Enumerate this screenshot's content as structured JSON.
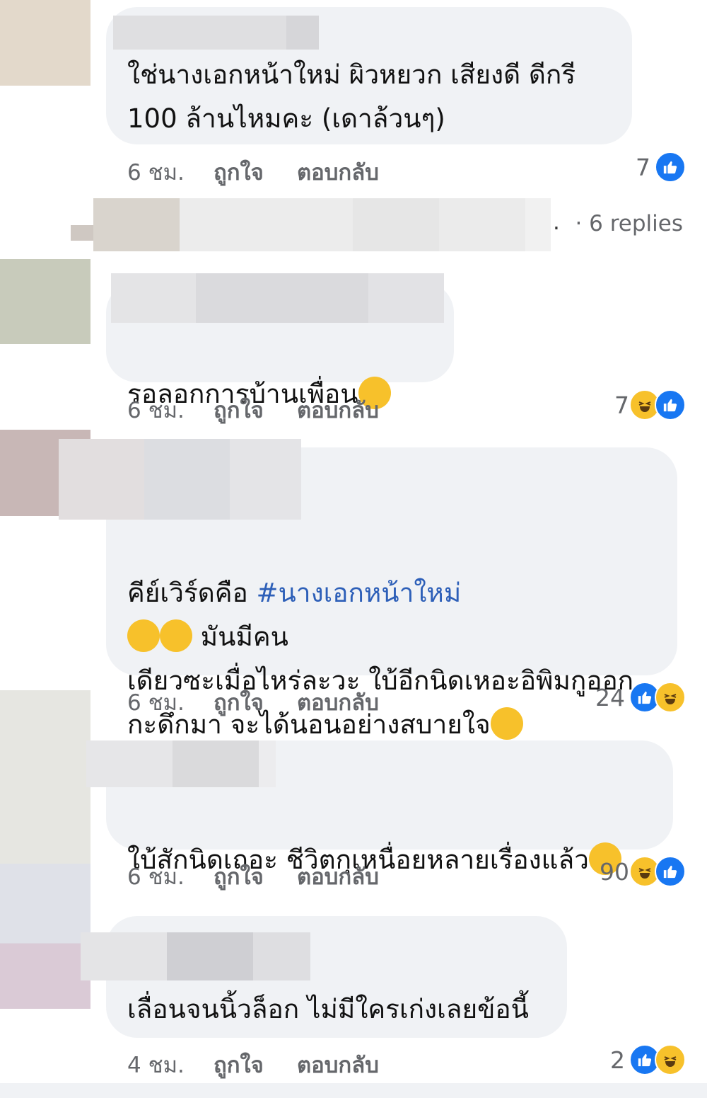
{
  "colors": {
    "bubble": "#f0f2f5",
    "meta": "#65676b",
    "like_blue": "#1877f2",
    "haha_yellow": "#f7c12b",
    "hashtag": "#2d5fb8"
  },
  "comments": [
    {
      "text": "ใช่นางเอกหน้าใหม่ ผิวหยวก  เสียงดี ดีกรี\n100 ล้านไหมคะ (เดาล้วนๆ)",
      "time": "6 ชม.",
      "like_label": "ถูกใจ",
      "reply_label": "ตอบกลับ",
      "reaction_count": "7",
      "reaction_icons": [
        "like-icon"
      ]
    },
    {
      "text": "รอลอกการบ้านเพื่อน",
      "trailing_emoji": "grinning-face-emoji",
      "time": "6 ชม.",
      "like_label": "ถูกใจ",
      "reply_label": "ตอบกลับ",
      "reaction_count": "7",
      "reaction_icons": [
        "haha-icon",
        "like-icon"
      ]
    },
    {
      "text_prefix": "คีย์เวิร์ดคือ ",
      "hashtag": "#นางเอกหน้าใหม่",
      "text_suffix": " มันมีคน\nเดียวซะเมื่อไหร่ละวะ ใบ้อีกนิดเหอะอิพิมกูออก\nกะดึกมา จะได้นอนอย่างสบายใจ",
      "inline_emojis": [
        "tears-of-joy-emoji",
        "tears-of-joy-emoji"
      ],
      "trailing_emoji": "disappointed-face-emoji",
      "time": "6 ชม.",
      "like_label": "ถูกใจ",
      "reply_label": "ตอบกลับ",
      "reaction_count": "24",
      "reaction_icons": [
        "like-icon",
        "haha-icon"
      ]
    },
    {
      "text": "ใบ้สักนิดเถอะ ชีวิตกุเหนื่อยหลายเรื่องแล้ว",
      "trailing_emoji": "medical-mask-face-emoji",
      "time": "6 ชม.",
      "like_label": "ถูกใจ",
      "reply_label": "ตอบกลับ",
      "reaction_count": "90",
      "reaction_icons": [
        "haha-icon",
        "like-icon"
      ]
    },
    {
      "text": "เลื่อนจนนิ้วล็อก ไม่มีใครเก่งเลยข้อนี้",
      "time": "4 ชม.",
      "like_label": "ถูกใจ",
      "reply_label": "ตอบกลับ",
      "reaction_count": "2",
      "reaction_icons": [
        "like-icon",
        "haha-icon"
      ]
    }
  ],
  "replies_link": {
    "dot": ".",
    "label": "· 6 replies"
  }
}
